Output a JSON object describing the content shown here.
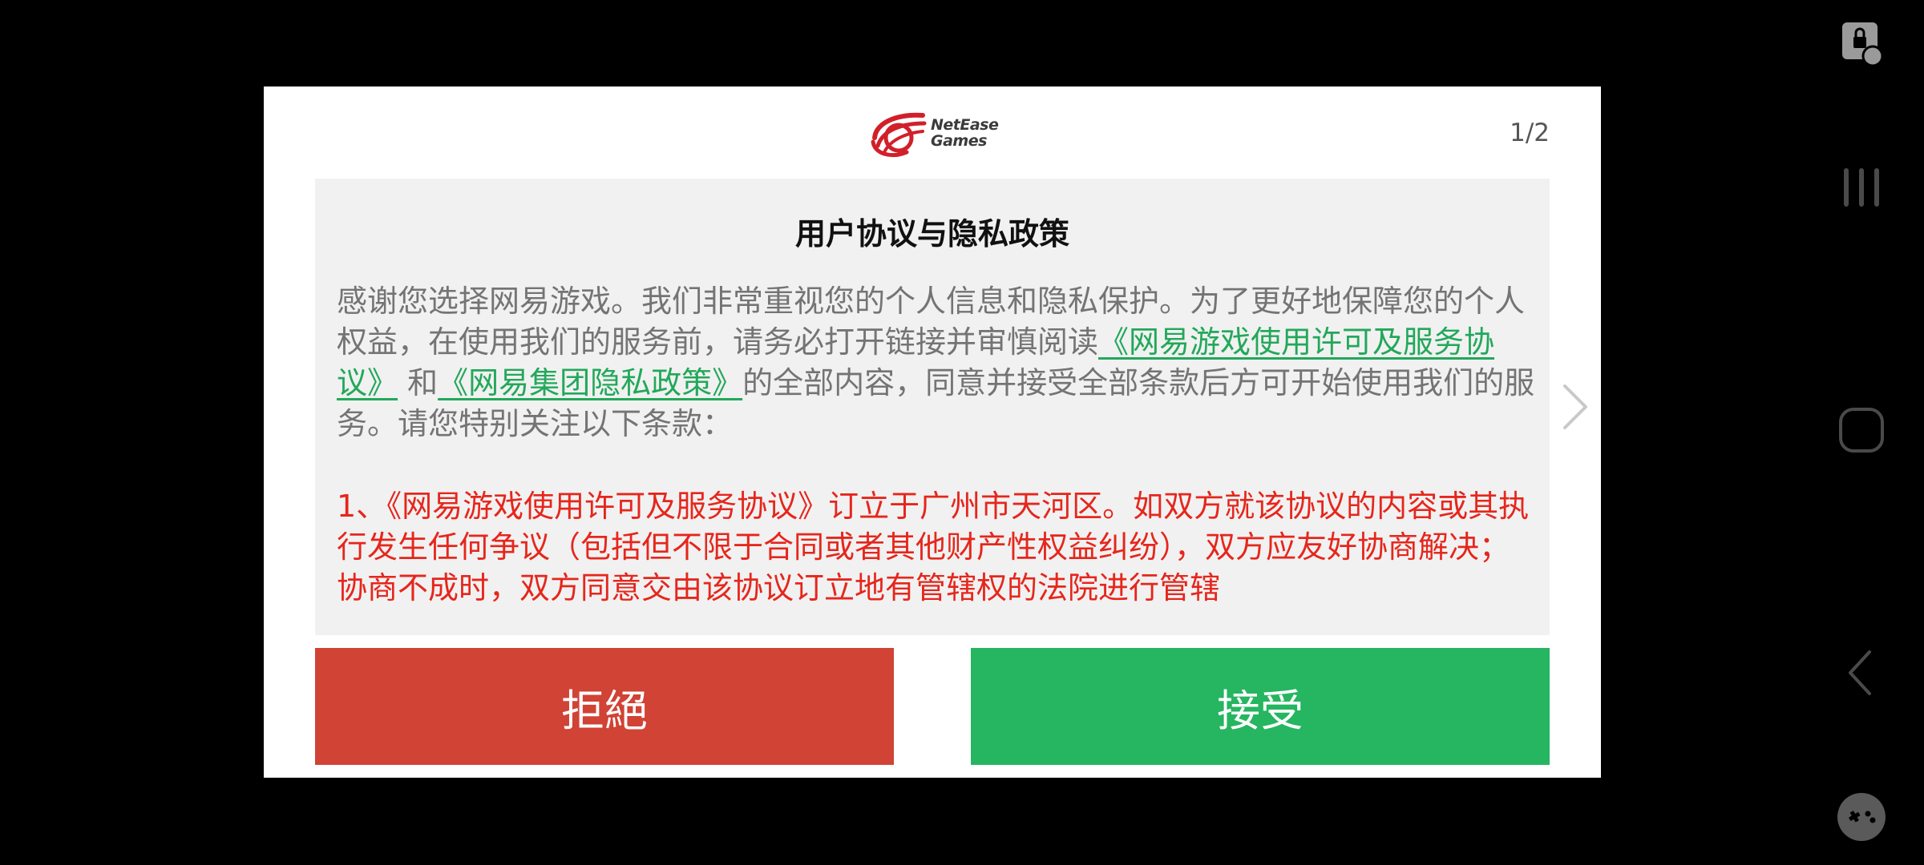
{
  "dialog": {
    "logo_text_line1": "NetEase",
    "logo_text_line2": "Games",
    "page_indicator": "1/2",
    "title": "用户协议与隐私政策",
    "body_part1": "感谢您选择网易游戏。我们非常重视您的个人信息和隐私保护。为了更好地保障您的个人权益，在使用我们的服务前，请务必打开链接并审慎阅读",
    "link_service_agreement": "《网易游戏使用许可及服务协议》",
    "body_and": " 和",
    "link_privacy_policy": "《网易集团隐私政策》",
    "body_part2": "的全部内容，同意并接受全部条款后方可开始使用我们的服务。请您特别关注以下条款：",
    "clause_1": "1、《网易游戏使用许可及服务协议》订立于广州市天河区。如双方就该协议的内容或其执行发生任何争议（包括但不限于合同或者其他财产性权益纠纷），双方应友好协商解决；协商不成时，双方同意交由该协议订立地有管辖权的法院进行管辖",
    "reject_label": "拒絕",
    "accept_label": "接受"
  },
  "colors": {
    "reject": "#d04335",
    "accept": "#26b560",
    "link": "#22a85a",
    "warning_text": "#e6261c",
    "logo_red": "#d1202a"
  },
  "icons": {
    "next": "chevron-right-icon",
    "screen_lock": "screen-lock-icon",
    "recent_apps": "recent-apps-icon",
    "home": "home-icon",
    "back": "back-icon",
    "game_tools": "gamepad-icon"
  }
}
